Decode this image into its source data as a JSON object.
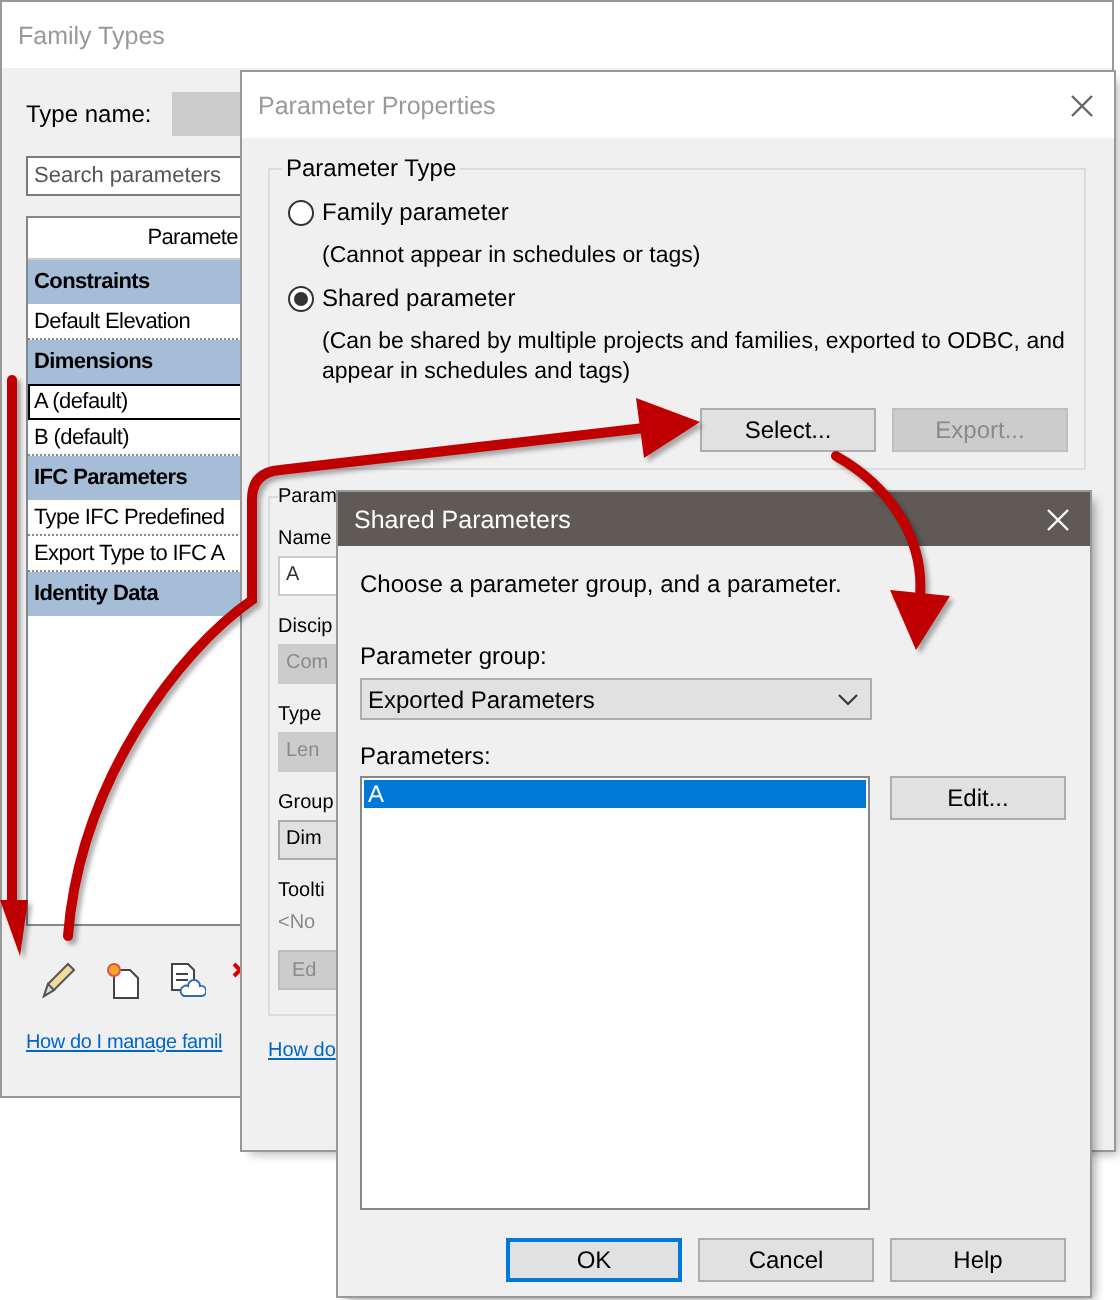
{
  "family_types": {
    "title": "Family Types",
    "type_name_label": "Type name:",
    "search": {
      "placeholder": "Search parameters"
    },
    "table": {
      "header": "Paramete",
      "rows": [
        {
          "kind": "group",
          "text": "Constraints",
          "selected": false
        },
        {
          "kind": "param",
          "text": "Default Elevation",
          "selected": false
        },
        {
          "kind": "group",
          "text": "Dimensions",
          "selected": false
        },
        {
          "kind": "param",
          "text": "A (default)",
          "selected": true
        },
        {
          "kind": "param",
          "text": "B (default)",
          "selected": false
        },
        {
          "kind": "group",
          "text": "IFC Parameters",
          "selected": false
        },
        {
          "kind": "param",
          "text": "Type IFC Predefined",
          "selected": false
        },
        {
          "kind": "param",
          "text": "Export Type to IFC A",
          "selected": false
        },
        {
          "kind": "group",
          "text": "Identity Data",
          "selected": false
        }
      ]
    },
    "help_link": "How do I manage famil"
  },
  "parameter_properties": {
    "title": "Parameter Properties",
    "parameter_type": {
      "legend": "Parameter Type",
      "options": [
        {
          "label": "Family parameter",
          "description": "(Cannot appear in schedules or tags)",
          "selected": false
        },
        {
          "label": "Shared parameter",
          "description": "(Can be shared by multiple projects and families, exported to ODBC, and appear in schedules and tags)",
          "selected": true
        }
      ],
      "buttons": [
        {
          "label": "Select...",
          "disabled": false
        },
        {
          "label": "Export...",
          "disabled": true
        }
      ]
    },
    "details": {
      "legend": "Param",
      "fields": [
        {
          "label": "Name",
          "kind": "text",
          "value": "A",
          "disabled": false
        },
        {
          "label": "Discip",
          "kind": "combo",
          "value": "Com",
          "disabled": true
        },
        {
          "label": "Type",
          "kind": "combo",
          "value": "Len",
          "disabled": true
        },
        {
          "label": "Group",
          "kind": "combo",
          "value": "Dim",
          "disabled": false
        },
        {
          "label": "Toolti",
          "kind": "note",
          "value": "<No",
          "disabled": true
        }
      ],
      "edit_button": {
        "label": "Ed",
        "disabled": true
      }
    },
    "help_link": "How do"
  },
  "shared_parameters": {
    "title": "Shared Parameters",
    "instruction": "Choose a parameter group, and a parameter.",
    "group_label": "Parameter group:",
    "group_value": "Exported Parameters",
    "parameters_label": "Parameters:",
    "parameters": [
      {
        "text": "A",
        "selected": true
      }
    ],
    "edit_button": "Edit...",
    "buttons": [
      {
        "label": "OK",
        "focused": true
      },
      {
        "label": "Cancel",
        "focused": false
      },
      {
        "label": "Help",
        "focused": false
      }
    ]
  }
}
